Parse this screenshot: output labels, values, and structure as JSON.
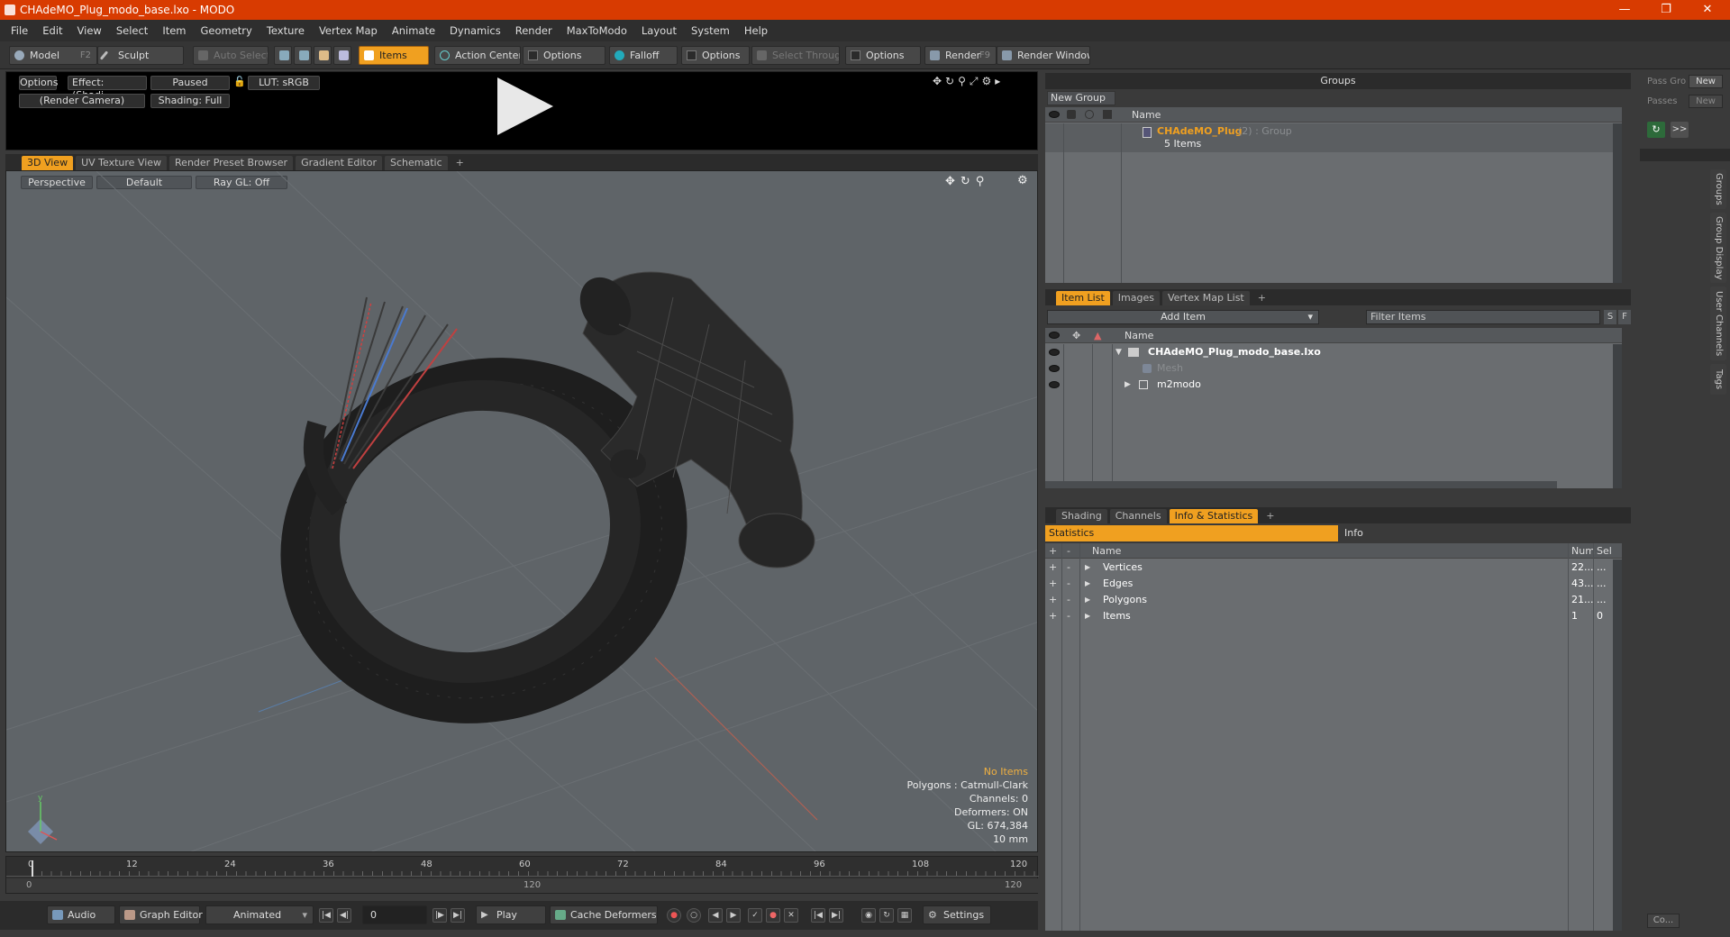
{
  "window": {
    "title": "CHAdeMO_Plug_modo_base.lxo - MODO"
  },
  "menu": [
    "File",
    "Edit",
    "View",
    "Select",
    "Item",
    "Geometry",
    "Texture",
    "Vertex Map",
    "Animate",
    "Dynamics",
    "Render",
    "MaxToModo",
    "Layout",
    "System",
    "Help"
  ],
  "toolbar": {
    "model": "Model",
    "model_key": "F2",
    "sculpt": "Sculpt",
    "auto_select": "Auto Select",
    "items": "Items",
    "action_center": "Action Center",
    "options1": "Options",
    "falloff": "Falloff",
    "options2": "Options",
    "select_through": "Select Through",
    "options3": "Options",
    "render": "Render",
    "render_key": "F9",
    "render_window": "Render Window"
  },
  "preview": {
    "options": "Options",
    "effect": "Effect: (Shadi...",
    "paused": "Paused",
    "lut": "LUT: sRGB",
    "camera": "(Render Camera)",
    "shading": "Shading: Full"
  },
  "view_tabs": [
    "3D View",
    "UV Texture View",
    "Render Preset Browser",
    "Gradient Editor",
    "Schematic",
    "+"
  ],
  "viewport": {
    "perspective": "Perspective",
    "default": "Default",
    "raygl": "Ray GL: Off",
    "info_items": "No Items",
    "info_lines": [
      "Polygons : Catmull-Clark",
      "Channels: 0",
      "Deformers: ON",
      "GL: 674,384",
      "10 mm"
    ]
  },
  "timeline": {
    "ticks_top": [
      "0",
      "12",
      "24",
      "36",
      "48",
      "60",
      "72",
      "84",
      "96",
      "108",
      "120"
    ],
    "ticks_bottom": [
      "0",
      "120",
      "120"
    ]
  },
  "bottombar": {
    "audio": "Audio",
    "graph_editor": "Graph Editor",
    "animated": "Animated",
    "frame": "0",
    "play": "Play",
    "cache_deformers": "Cache Deformers",
    "settings": "Settings"
  },
  "groups": {
    "title": "Groups",
    "new_group": "New Group",
    "col_name": "Name",
    "row_name": "CHAdeMO_Plug",
    "row_suffix": "(2) : Group",
    "row_sub": "5 Items"
  },
  "pass": {
    "pass_grp": "Pass Gro",
    "passes": "Passes",
    "new1": "New",
    "new2": "New",
    "more": ">>"
  },
  "itemlist": {
    "tabs": [
      "Item List",
      "Images",
      "Vertex Map List",
      "+"
    ],
    "add_item": "Add Item",
    "filter": "Filter Items",
    "s": "S",
    "f": "F",
    "col_name": "Name",
    "rows": [
      {
        "name": "CHAdeMO_Plug_modo_base.lxo"
      },
      {
        "name": "Mesh"
      },
      {
        "name": "m2modo"
      }
    ]
  },
  "stats": {
    "tabs": [
      "Shading",
      "Channels",
      "Info & Statistics",
      "+"
    ],
    "statistics": "Statistics",
    "info": "Info",
    "col_name": "Name",
    "col_num": "Num",
    "col_sel": "Sel",
    "rows": [
      {
        "name": "Vertices",
        "num": "22...",
        "sel": "..."
      },
      {
        "name": "Edges",
        "num": "43...",
        "sel": "..."
      },
      {
        "name": "Polygons",
        "num": "21...",
        "sel": "..."
      },
      {
        "name": "Items",
        "num": "1",
        "sel": "0"
      }
    ]
  },
  "sidetabs": [
    "Groups",
    "Group Display",
    "User Channels",
    "Tags"
  ],
  "corner": {
    "co": "Co..."
  }
}
